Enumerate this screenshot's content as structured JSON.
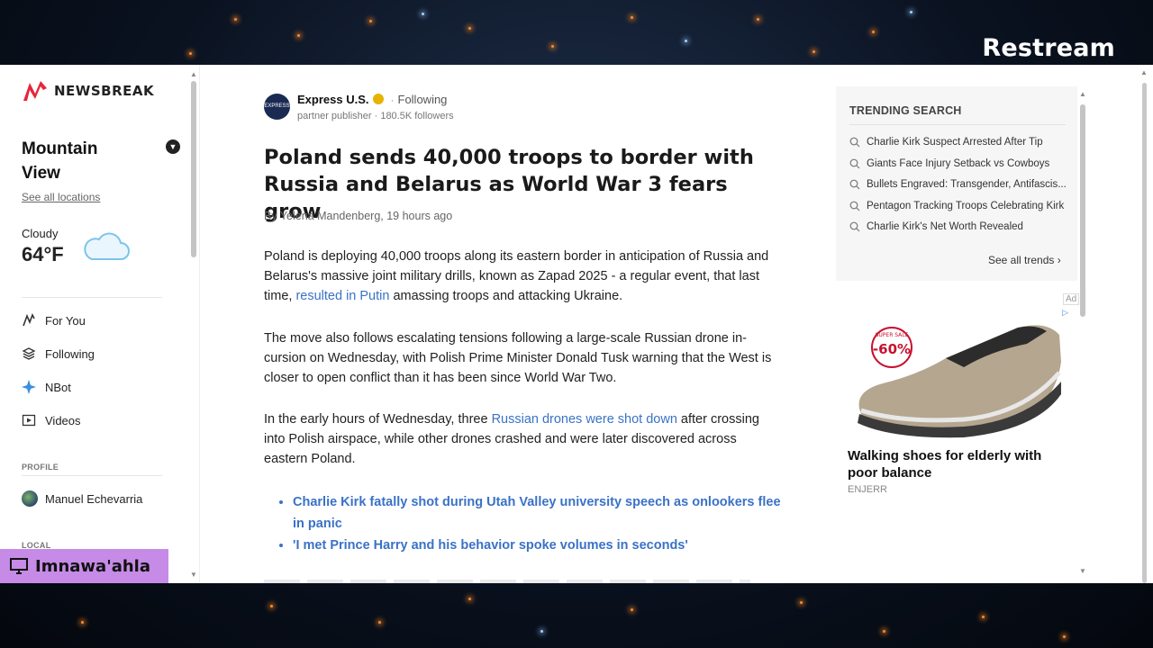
{
  "overlay": {
    "brand": "Restream",
    "username": "Imnawa'ahla"
  },
  "sidebar": {
    "logo_text": "NEWSBREAK",
    "location": "Mountain View",
    "see_all_locations": "See all locations",
    "weather": {
      "condition": "Cloudy",
      "temperature": "64°F"
    },
    "nav": [
      {
        "label": "For You",
        "icon": "for-you-icon"
      },
      {
        "label": "Following",
        "icon": "layers-icon"
      },
      {
        "label": "NBot",
        "icon": "sparkle-icon"
      },
      {
        "label": "Videos",
        "icon": "video-icon"
      }
    ],
    "profile_label": "PROFILE",
    "profile_name": "Manuel Echevarria",
    "local_label": "LOCAL"
  },
  "article": {
    "publisher": "Express U.S.",
    "publisher_logo_text": "EXPRESS",
    "following": "Following",
    "publisher_meta": "partner publisher · 180.5K followers",
    "headline": "Poland sends 40,000 troops to border with Russia and Belarus as World War 3 fears grow",
    "byline": "By Yelena Mandenberg, 19 hours ago",
    "p1_before": "Poland is deploying 40,000 troops along its eastern border in anticipation of Russia and Belarus's massive joint military drills, known as Zapad 2025 - a regular event, that last time, ",
    "p1_link": "resulted in Putin",
    "p1_after": " amassing troops and attacking Ukraine.",
    "p2": "The move also follows escalating tensions following a large-scale Russian drone in-cursion on Wednesday, with Polish Prime Minister Donald Tusk warning that the West is closer to open conflict than it has been since World War Two.",
    "p3_before": "In the early hours of Wednesday, three ",
    "p3_link": "Russian drones were shot down",
    "p3_after": " after crossing into Polish airspace, while other drones crashed and were later discovered across eastern Poland.",
    "related": [
      "Charlie Kirk fatally shot during Utah Valley university speech as onlookers flee in panic",
      "'I met Prince Harry and his behavior spoke volumes in seconds'"
    ]
  },
  "trending": {
    "title": "TRENDING SEARCH",
    "items": [
      "Charlie Kirk Suspect Arrested After Tip",
      "Giants Face Injury Setback vs Cowboys",
      "Bullets Engraved: Transgender, Antifascis...",
      "Pentagon Tracking Troops Celebrating Kirk",
      "Charlie Kirk's Net Worth Revealed"
    ],
    "see_all": "See all trends"
  },
  "ad": {
    "label": "Ad",
    "sale_badge": "-60%",
    "sale_text": "SUPER SALE",
    "title": "Walking shoes for elderly with poor balance",
    "brand": "ENJERR"
  },
  "colors": {
    "link": "#3a72c6",
    "brand_red": "#e8253b",
    "overlay_purple": "#c58be6"
  }
}
